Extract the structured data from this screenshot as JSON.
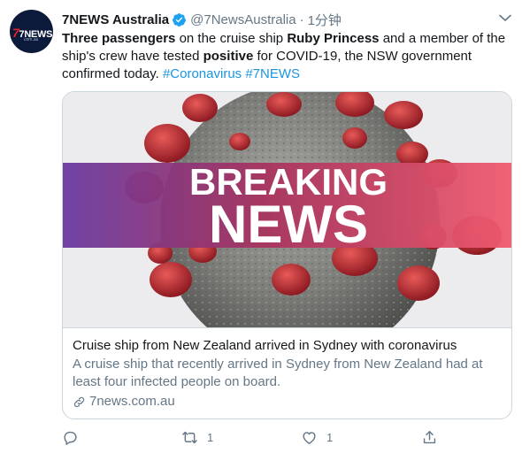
{
  "tweet": {
    "author_name": "7NEWS Australia",
    "handle": "@7NewsAustralia",
    "separator": "·",
    "time": "1分钟",
    "avatar": {
      "logo_text": "7NEWS",
      "logo_sub": "com.au"
    },
    "text": {
      "p1": "Three passengers",
      "p2": " on the cruise ship ",
      "p3": "Ruby Princess",
      "p4": " and a member of the ship's crew have tested ",
      "p5": "positive",
      "p6": " for COVID-19, the NSW government confirmed today. ",
      "tag1": "#Coronavirus",
      "tag_gap": " ",
      "tag2": "#7NEWS"
    },
    "card": {
      "image_line1": "BREAKING",
      "image_line2": "NEWS",
      "title": "Cruise ship from New Zealand arrived in Sydney with coronavirus",
      "description": "A cruise ship that recently arrived in Sydney from New Zealand had at least four infected people on board.",
      "domain": "7news.com.au"
    },
    "actions": {
      "reply_count": "",
      "retweet_count": "1",
      "like_count": "1"
    }
  },
  "colors": {
    "link": "#1b95e0",
    "secondary_text": "#657786",
    "border": "#ccd6dd",
    "verified": "#1da1f2",
    "banner_left": "#6a3aa0",
    "banner_right": "#f05a6e",
    "virus_spike": "#c8262e"
  },
  "icons": [
    "verified-badge-icon",
    "chevron-down-icon",
    "link-icon",
    "reply-icon",
    "retweet-icon",
    "like-icon",
    "share-icon"
  ]
}
